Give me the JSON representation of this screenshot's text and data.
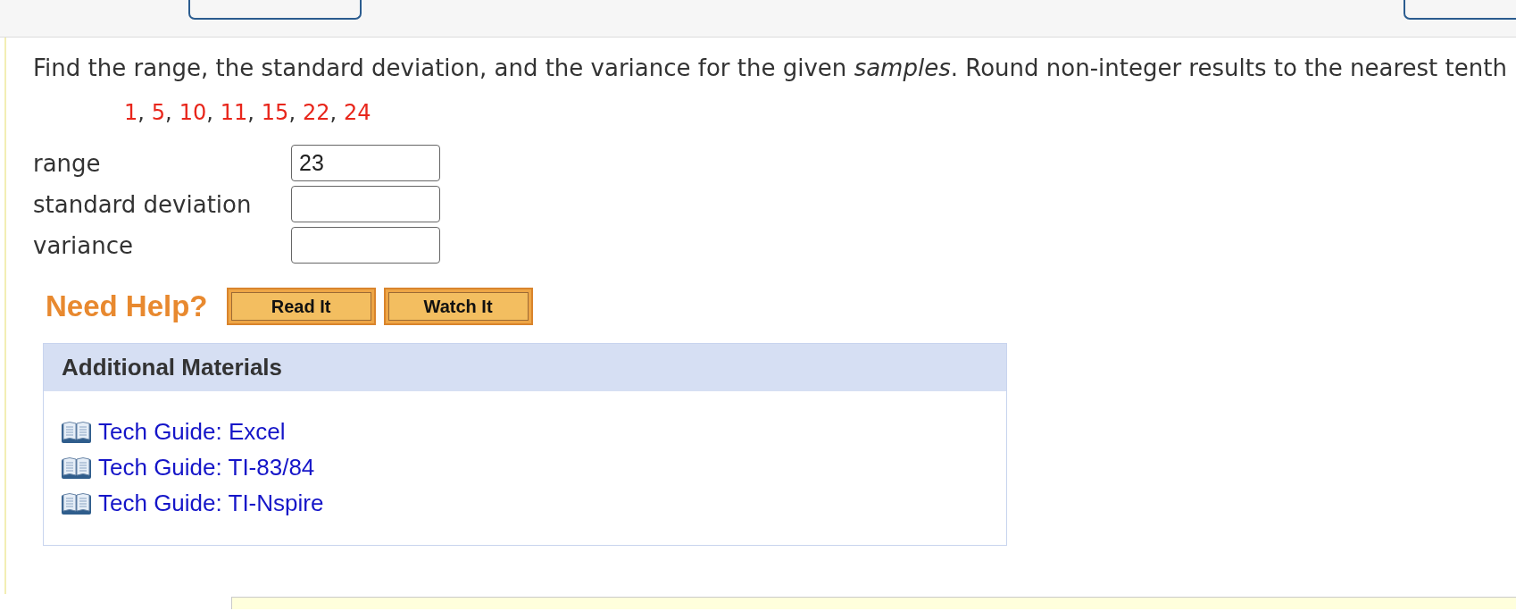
{
  "question": {
    "text": "Find the range, the standard deviation, and the variance for the given *samples*. Round non-integer results to the nearest tenth",
    "samples": [
      "1",
      "5",
      "10",
      "11",
      "15",
      "22",
      "24"
    ],
    "separator": ","
  },
  "answers": [
    {
      "label": "range",
      "value": "23"
    },
    {
      "label": "standard deviation"
    },
    {
      "label": "variance"
    }
  ],
  "help": {
    "label": "Need Help?",
    "buttons": [
      "Read It",
      "Watch It"
    ]
  },
  "additional_materials": {
    "title": "Additional Materials",
    "links": [
      "Tech Guide: Excel",
      "Tech Guide: TI-83/84",
      "Tech Guide: TI-Nspire"
    ]
  }
}
